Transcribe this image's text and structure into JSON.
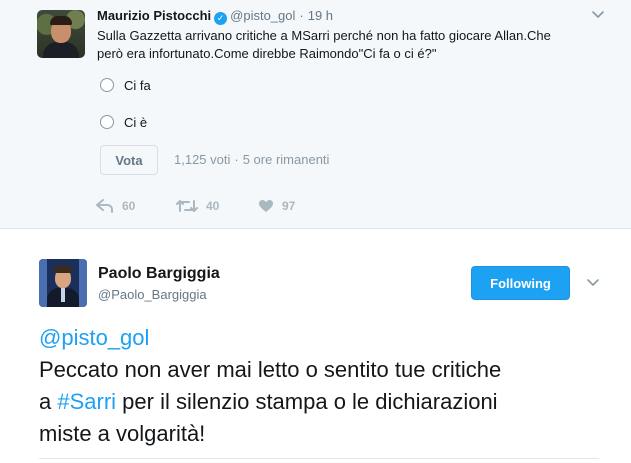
{
  "quoted_tweet": {
    "author_name": "Maurizio Pistocchi",
    "verified": true,
    "handle": "@pisto_gol",
    "separator": "·",
    "time": "19 h",
    "text_line1": "Sulla Gazzetta arrivano critiche a MSarri perché non ha fatto giocare Allan.Che",
    "text_line2": "però era infortunato.Come direbbe Raimondo\"Ci fa o ci é?\"",
    "poll": {
      "options": [
        "Ci fa",
        "Ci è"
      ],
      "vote_label": "Vota",
      "votes": "1,125 voti",
      "meta_separator": "·",
      "remaining": "5 ore rimanenti"
    },
    "actions": {
      "replies": "60",
      "retweets": "40",
      "likes": "97"
    }
  },
  "main_tweet": {
    "author_name": "Paolo Bargiggia",
    "handle": "@Paolo_Bargiggia",
    "follow_label": "Following",
    "mention": "@pisto_gol",
    "text_part1": "Peccato non aver mai letto o sentito tue critiche",
    "text_part2_prefix": "a ",
    "hashtag": "#Sarri",
    "text_part2_suffix": " per il silenzio stampa o le dichiarazioni",
    "text_part3": "miste a volgarità!"
  },
  "colors": {
    "accent": "#1da1f2",
    "muted": "#657786",
    "quoted_background": "#f5f8fa"
  },
  "icons": [
    "verified-badge-icon",
    "chevron-down-icon",
    "reply-icon",
    "retweet-icon",
    "heart-icon"
  ]
}
